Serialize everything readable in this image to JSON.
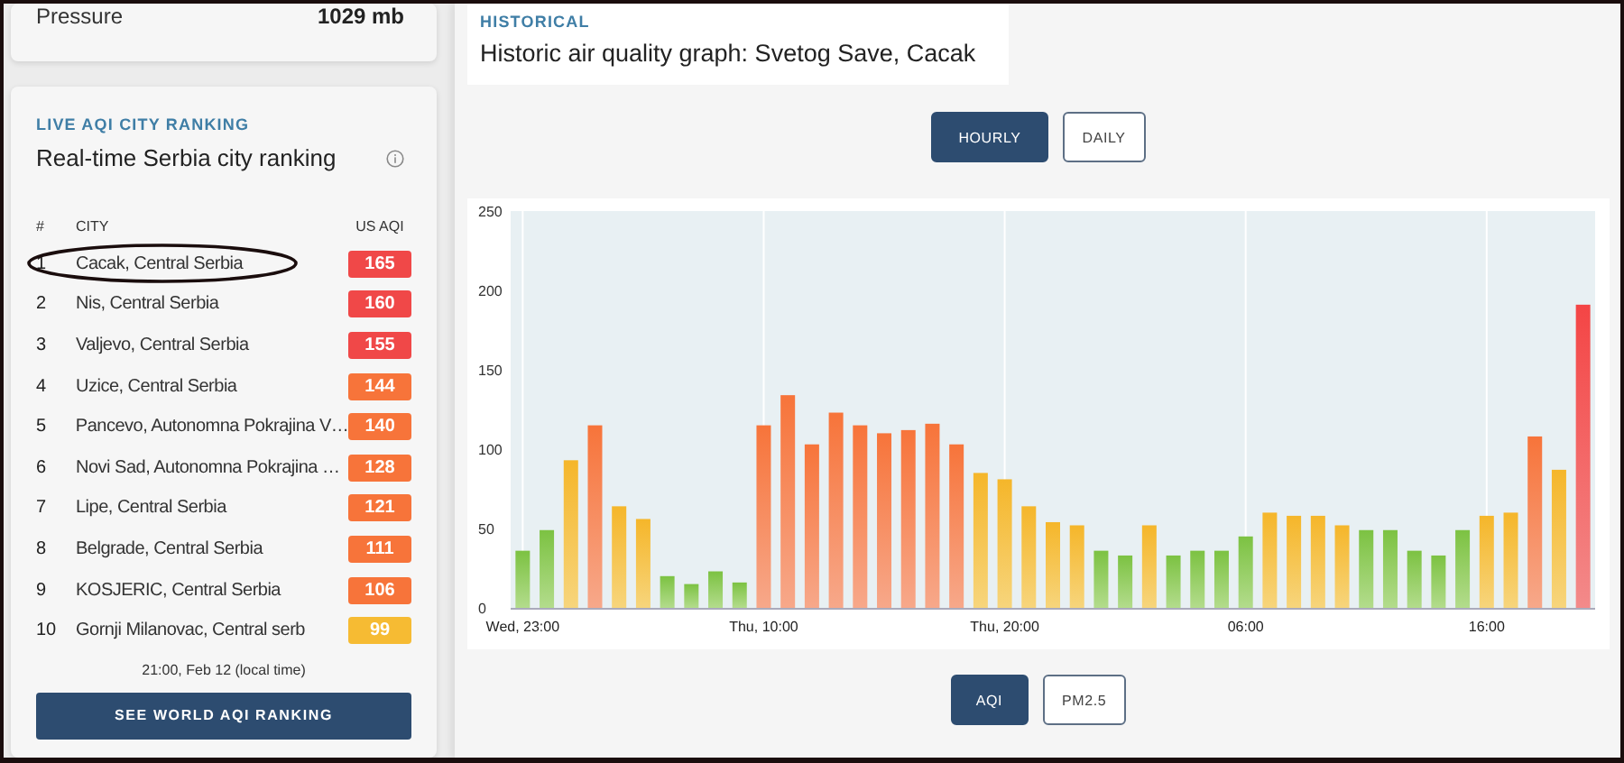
{
  "weather": {
    "label": "Pressure",
    "value": "1029 mb"
  },
  "ranking": {
    "eyebrow": "LIVE AQI CITY RANKING",
    "title": "Real-time Serbia city ranking",
    "columns": [
      "#",
      "CITY",
      "US AQI"
    ],
    "rows": [
      {
        "rank": "1",
        "city": "Cacak, Central Serbia",
        "aqi": "165",
        "color": "#f04848",
        "highlighted": true
      },
      {
        "rank": "2",
        "city": "Nis, Central Serbia",
        "aqi": "160",
        "color": "#f04848",
        "highlighted": false
      },
      {
        "rank": "3",
        "city": "Valjevo, Central Serbia",
        "aqi": "155",
        "color": "#f04848",
        "highlighted": false
      },
      {
        "rank": "4",
        "city": "Uzice, Central Serbia",
        "aqi": "144",
        "color": "#f7743a",
        "highlighted": false
      },
      {
        "rank": "5",
        "city": "Pancevo, Autonomna Pokrajina V…",
        "aqi": "140",
        "color": "#f7743a",
        "highlighted": false
      },
      {
        "rank": "6",
        "city": "Novi Sad, Autonomna Pokrajina …",
        "aqi": "128",
        "color": "#f7743a",
        "highlighted": false
      },
      {
        "rank": "7",
        "city": "Lipe, Central Serbia",
        "aqi": "121",
        "color": "#f7743a",
        "highlighted": false
      },
      {
        "rank": "8",
        "city": "Belgrade, Central Serbia",
        "aqi": "111",
        "color": "#f7743a",
        "highlighted": false
      },
      {
        "rank": "9",
        "city": "KOSJERIC, Central Serbia",
        "aqi": "106",
        "color": "#f7743a",
        "highlighted": false
      },
      {
        "rank": "10",
        "city": "Gornji Milanovac, Central serb",
        "aqi": "99",
        "color": "#f6bb33",
        "highlighted": false
      }
    ],
    "timestamp": "21:00, Feb 12 (local time)",
    "button": "SEE WORLD AQI RANKING"
  },
  "historical": {
    "eyebrow": "HISTORICAL",
    "title": "Historic air quality graph: Svetog Save, Cacak",
    "range_tabs": [
      {
        "label": "HOURLY",
        "selected": true
      },
      {
        "label": "DAILY",
        "selected": false
      }
    ],
    "chart_data": {
      "type": "bar",
      "categories": [
        "Wed, 23:00",
        null,
        null,
        null,
        null,
        null,
        null,
        null,
        null,
        null,
        "Thu, 10:00",
        null,
        null,
        null,
        null,
        null,
        null,
        null,
        null,
        null,
        "Thu, 20:00",
        null,
        null,
        null,
        null,
        null,
        null,
        null,
        null,
        null,
        "06:00",
        null,
        null,
        null,
        null,
        null,
        null,
        null,
        null,
        null,
        "16:00",
        null,
        null,
        null,
        null
      ],
      "series": [
        {
          "values": [
            36,
            49,
            93,
            115,
            64,
            56,
            20,
            15,
            23,
            16,
            115,
            134,
            103,
            123,
            115,
            110,
            112,
            116,
            103,
            85,
            81,
            64,
            54,
            52,
            36,
            33,
            52,
            33,
            36,
            36,
            45,
            60,
            58,
            58,
            52,
            49,
            49,
            36,
            33,
            49,
            58,
            60,
            108,
            87,
            191
          ]
        }
      ],
      "ylim": [
        0,
        250
      ],
      "yticks": [
        0,
        50,
        100,
        150,
        200,
        250
      ],
      "grid": true
    },
    "metric_tabs": [
      {
        "label": "AQI",
        "selected": true
      },
      {
        "label": "PM2.5",
        "selected": false
      }
    ]
  }
}
